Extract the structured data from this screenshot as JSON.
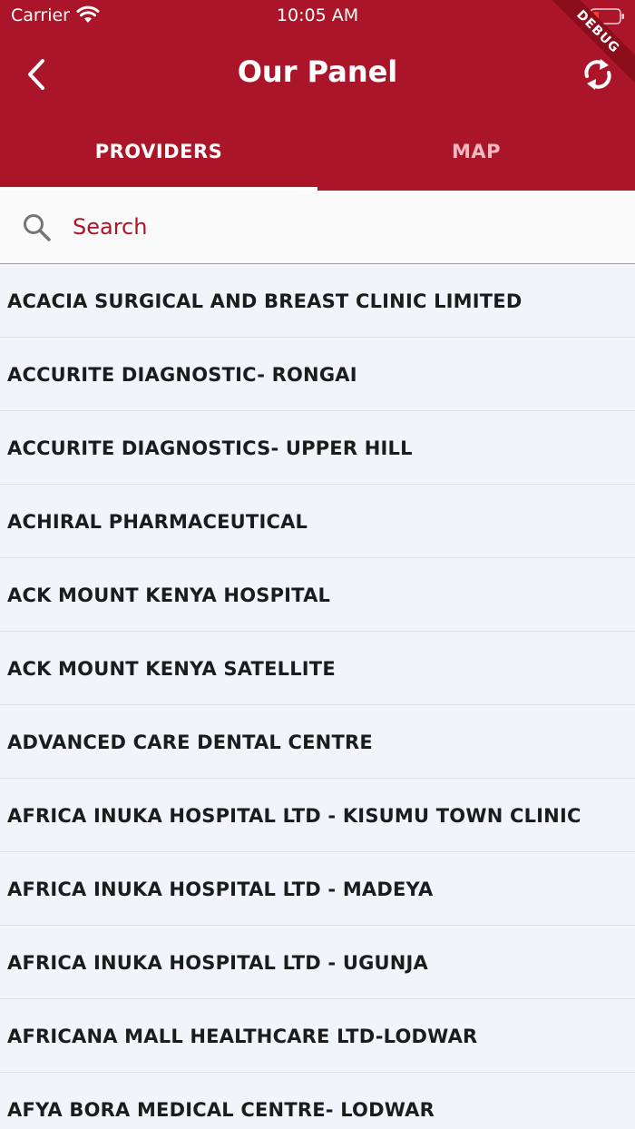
{
  "status_bar": {
    "carrier": "Carrier",
    "time": "10:05 AM",
    "debug_banner": "DEBUG"
  },
  "app_bar": {
    "title": "Our Panel",
    "back_icon": "chevron-left-icon",
    "refresh_icon": "sync-icon"
  },
  "tabs": [
    {
      "label": "PROVIDERS",
      "selected": true
    },
    {
      "label": "MAP",
      "selected": false
    }
  ],
  "search": {
    "placeholder": "Search",
    "value": ""
  },
  "providers": [
    "ACACIA SURGICAL AND BREAST CLINIC LIMITED",
    "ACCURITE DIAGNOSTIC- RONGAI",
    "ACCURITE DIAGNOSTICS- UPPER HILL",
    "ACHIRAL PHARMACEUTICAL",
    "ACK MOUNT KENYA HOSPITAL",
    "ACK MOUNT KENYA SATELLITE",
    "ADVANCED CARE DENTAL CENTRE",
    "AFRICA INUKA HOSPITAL LTD - KISUMU TOWN CLINIC",
    "AFRICA INUKA HOSPITAL LTD - MADEYA",
    "AFRICA INUKA HOSPITAL LTD - UGUNJA",
    "AFRICANA MALL HEALTHCARE LTD-LODWAR",
    "AFYA BORA MEDICAL CENTRE- LODWAR"
  ],
  "colors": {
    "brand": "#ab1529",
    "tab_inactive": "#f4b8c0",
    "list_background": "#f1f5f9",
    "text": "#1c1c1c"
  }
}
